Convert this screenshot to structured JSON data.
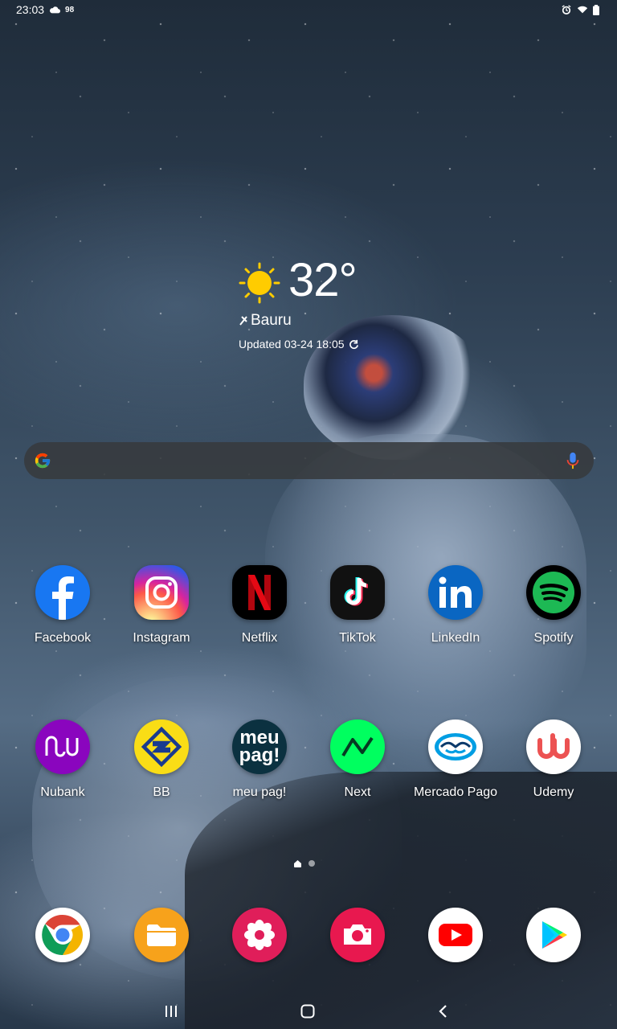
{
  "status_bar": {
    "time": "23:03",
    "notification_count": "98",
    "icons": [
      "cloud-icon",
      "alarm-icon",
      "wifi-icon",
      "battery-icon"
    ]
  },
  "weather": {
    "temperature": "32°",
    "city": "Bauru",
    "updated": "Updated 03-24 18:05",
    "icon": "sun-icon"
  },
  "search_bar": {
    "left_icon": "google-g-icon",
    "right_icon": "microphone-icon"
  },
  "apps_row1": [
    {
      "label": "Facebook",
      "icon": "facebook-icon",
      "color": "#1877f2"
    },
    {
      "label": "Instagram",
      "icon": "instagram-icon",
      "color": "#d6249f"
    },
    {
      "label": "Netflix",
      "icon": "netflix-icon",
      "color": "#e50914"
    },
    {
      "label": "TikTok",
      "icon": "tiktok-icon",
      "color": "#000000"
    },
    {
      "label": "LinkedIn",
      "icon": "linkedin-icon",
      "color": "#0a66c2"
    },
    {
      "label": "Spotify",
      "icon": "spotify-icon",
      "color": "#1db954"
    }
  ],
  "apps_row2": [
    {
      "label": "Nubank",
      "icon": "nubank-icon",
      "color": "#8a05be"
    },
    {
      "label": "BB",
      "icon": "bb-icon",
      "color": "#f9dd16"
    },
    {
      "label": "meu pag!",
      "icon": "meu-pag-icon",
      "color": "#0b3140",
      "icon_text_1": "meu",
      "icon_text_2": "pag!"
    },
    {
      "label": "Next",
      "icon": "next-icon",
      "color": "#00ff5f"
    },
    {
      "label": "Mercado Pago",
      "icon": "mercado-pago-icon",
      "color": "#009ee3"
    },
    {
      "label": "Udemy",
      "icon": "udemy-icon",
      "color": "#ec5252"
    }
  ],
  "dock": [
    {
      "icon": "chrome-icon"
    },
    {
      "icon": "files-icon",
      "color": "#f7a21b"
    },
    {
      "icon": "gallery-icon",
      "color": "#e01e5a"
    },
    {
      "icon": "camera-icon",
      "color": "#e8184f"
    },
    {
      "icon": "youtube-icon",
      "color": "#ff0000"
    },
    {
      "icon": "play-store-icon"
    }
  ],
  "navigation": [
    "recent-apps-icon",
    "home-icon",
    "back-icon"
  ]
}
